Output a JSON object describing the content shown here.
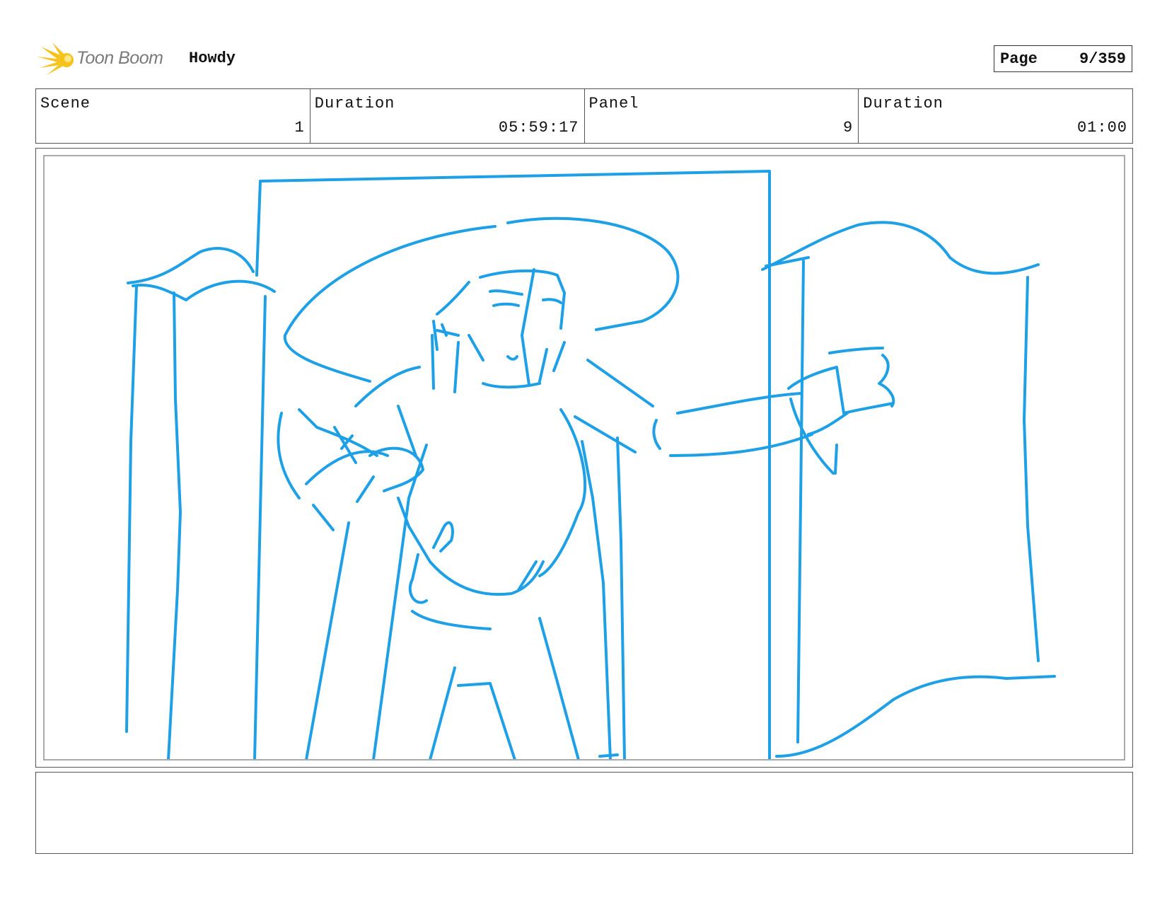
{
  "header": {
    "logo_text": "Toon Boom",
    "project_title": "Howdy",
    "page_label": "Page",
    "page_value": "9/359"
  },
  "info": {
    "scene_label": "Scene",
    "scene_value": "1",
    "scene_duration_label": "Duration",
    "scene_duration_value": "05:59:17",
    "panel_label": "Panel",
    "panel_value": "9",
    "panel_duration_label": "Duration",
    "panel_duration_value": "01:00"
  },
  "sketch": {
    "stroke_color": "#1ea0e6"
  },
  "notes": {
    "text": ""
  },
  "colors": {
    "logo_yellow": "#f6c21c",
    "logo_text_gray": "#7a7a7a"
  }
}
